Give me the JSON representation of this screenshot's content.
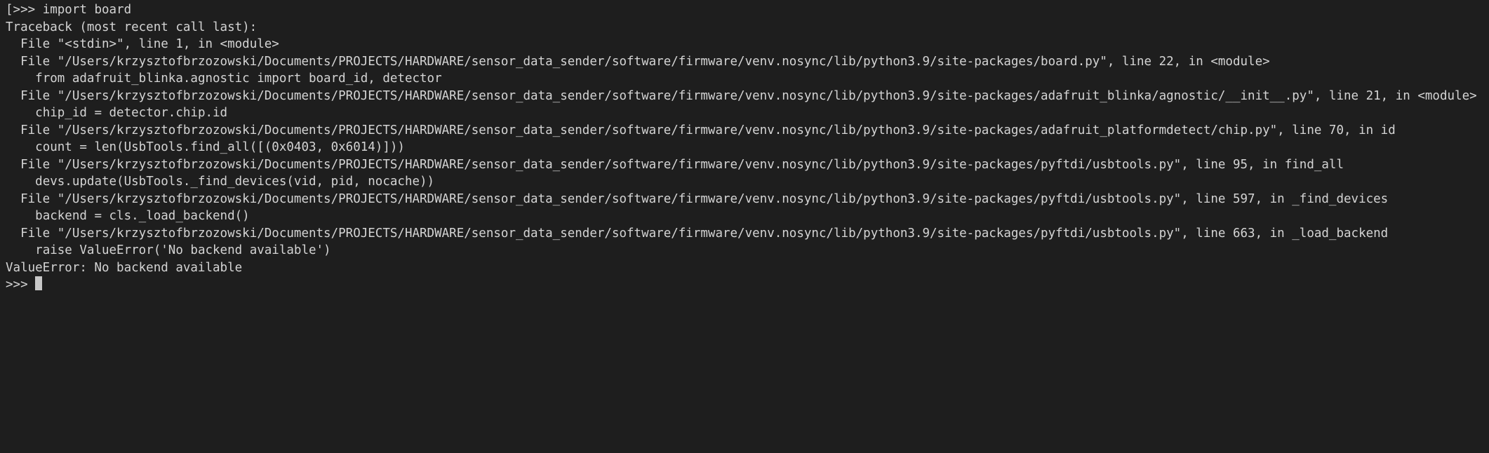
{
  "terminal": {
    "prompt_bracket_open": "[",
    "prompt_marker": ">>> ",
    "input_line": "import board",
    "traceback_header": "Traceback (most recent call last):",
    "frame1_line": "  File \"<stdin>\", line 1, in <module>",
    "frame2_file": "  File \"/Users/krzysztofbrzozowski/Documents/PROJECTS/HARDWARE/sensor_data_sender/software/firmware/venv.nosync/lib/python3.9/site-packages/board.py\", line 22, in <module>",
    "frame2_code": "    from adafruit_blinka.agnostic import board_id, detector",
    "frame3_file": "  File \"/Users/krzysztofbrzozowski/Documents/PROJECTS/HARDWARE/sensor_data_sender/software/firmware/venv.nosync/lib/python3.9/site-packages/adafruit_blinka/agnostic/__init__.py\", line 21, in <module>",
    "frame3_code": "    chip_id = detector.chip.id",
    "frame4_file": "  File \"/Users/krzysztofbrzozowski/Documents/PROJECTS/HARDWARE/sensor_data_sender/software/firmware/venv.nosync/lib/python3.9/site-packages/adafruit_platformdetect/chip.py\", line 70, in id",
    "frame4_code": "    count = len(UsbTools.find_all([(0x0403, 0x6014)]))",
    "frame5_file": "  File \"/Users/krzysztofbrzozowski/Documents/PROJECTS/HARDWARE/sensor_data_sender/software/firmware/venv.nosync/lib/python3.9/site-packages/pyftdi/usbtools.py\", line 95, in find_all",
    "frame5_code": "    devs.update(UsbTools._find_devices(vid, pid, nocache))",
    "frame6_file": "  File \"/Users/krzysztofbrzozowski/Documents/PROJECTS/HARDWARE/sensor_data_sender/software/firmware/venv.nosync/lib/python3.9/site-packages/pyftdi/usbtools.py\", line 597, in _find_devices",
    "frame6_code": "    backend = cls._load_backend()",
    "frame7_file": "  File \"/Users/krzysztofbrzozowski/Documents/PROJECTS/HARDWARE/sensor_data_sender/software/firmware/venv.nosync/lib/python3.9/site-packages/pyftdi/usbtools.py\", line 663, in _load_backend",
    "frame7_code": "    raise ValueError('No backend available')",
    "error_line": "ValueError: No backend available",
    "final_prompt": ">>> "
  }
}
